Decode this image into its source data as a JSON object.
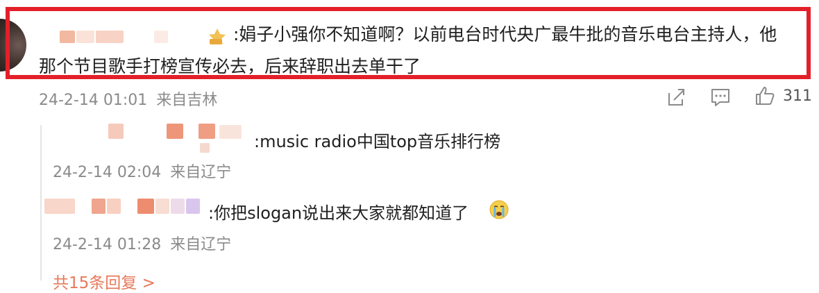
{
  "main_comment": {
    "text_line1": ":娟子小强你不知道啊？以前电台时代央广最牛批的音乐电台主持人，他",
    "text_line2": "那个节目歌手打榜宣传必去，后来辞职出去单干了",
    "date": "24-2-14 01:01",
    "location": "来自吉林",
    "like_count": "311",
    "icons": [
      "share-icon",
      "comment-icon",
      "like-icon"
    ],
    "badge_icon": "medal-icon"
  },
  "replies": [
    {
      "text": ":music radio中国top音乐排行榜",
      "date": "24-2-14 02:04",
      "location": "来自辽宁"
    },
    {
      "text": ":你把slogan说出来大家就都知道了",
      "emoji_icon": "crying-face-icon",
      "date": "24-2-14 01:28",
      "location": "来自辽宁"
    }
  ],
  "more_replies": "共15条回复 >",
  "colors": {
    "highlight_border": "#e3202a",
    "link": "#e8785a",
    "meta_text": "#8a8a8a"
  }
}
